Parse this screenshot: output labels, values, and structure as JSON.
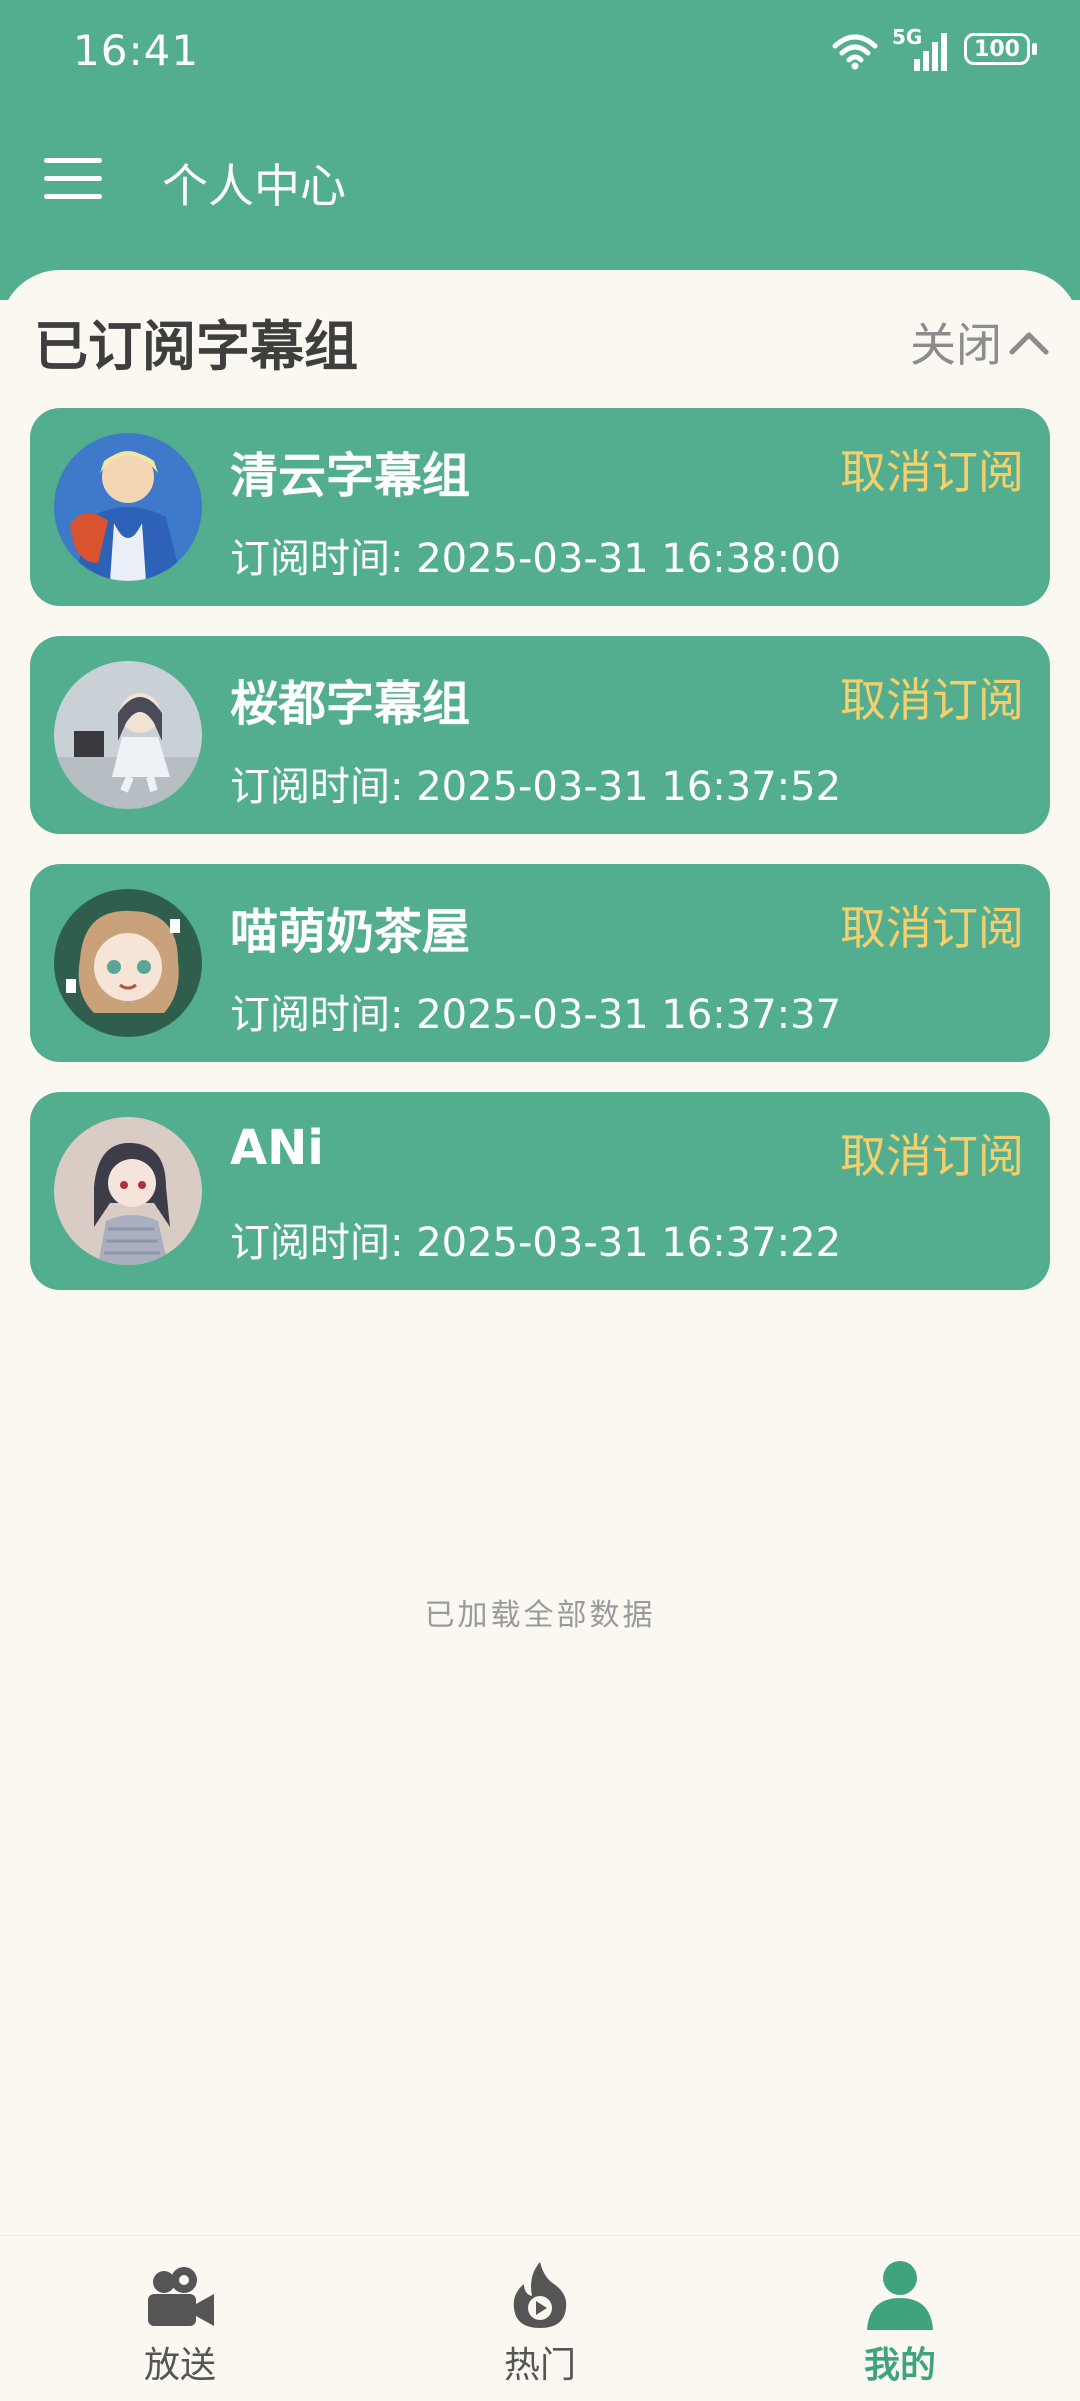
{
  "status_bar": {
    "time": "16:41",
    "network": "5G",
    "battery": "100"
  },
  "header": {
    "title": "个人中心"
  },
  "sheet": {
    "title": "已订阅字幕组",
    "close_label": "关闭"
  },
  "subscriptions": [
    {
      "name": "清云字幕组",
      "time_label": "订阅时间:",
      "time": "2025-03-31 16:38:00",
      "action": "取消订阅"
    },
    {
      "name": "桜都字幕组",
      "time_label": "订阅时间:",
      "time": "2025-03-31 16:37:52",
      "action": "取消订阅"
    },
    {
      "name": "喵萌奶茶屋",
      "time_label": "订阅时间:",
      "time": "2025-03-31 16:37:37",
      "action": "取消订阅"
    },
    {
      "name": "ANi",
      "time_label": "订阅时间:",
      "time": "2025-03-31 16:37:22",
      "action": "取消订阅"
    }
  ],
  "list_footer": "已加载全部数据",
  "bottom_nav": [
    {
      "label": "放送",
      "icon": "camera-icon",
      "active": false
    },
    {
      "label": "热门",
      "icon": "flame-icon",
      "active": false
    },
    {
      "label": "我的",
      "icon": "person-icon",
      "active": true
    }
  ],
  "colors": {
    "primary": "#52AE8E",
    "accent": "#F5CF6C",
    "background": "#FBF8F1"
  }
}
